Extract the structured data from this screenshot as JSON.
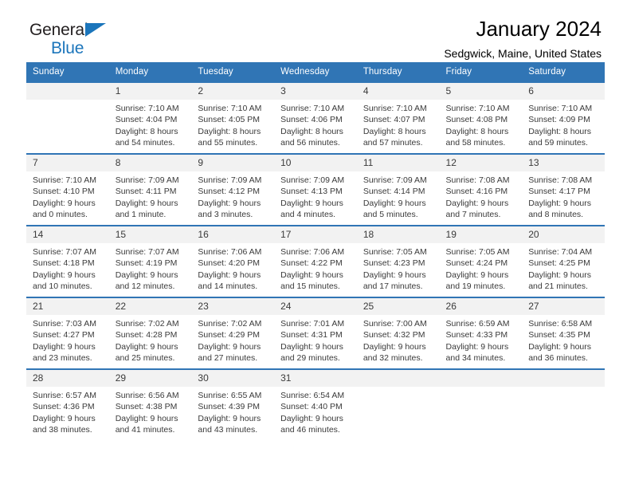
{
  "brand": {
    "line1": "General",
    "line2": "Blue",
    "accent_color": "#1b75bb"
  },
  "header": {
    "title": "January 2024",
    "subtitle": "Sedgwick, Maine, United States"
  },
  "theme": {
    "header_row_background": "#3075b5",
    "day_number_background": "#f2f2f2",
    "text_color": "#3a3a3a",
    "page_background": "#ffffff"
  },
  "weekdays": [
    "Sunday",
    "Monday",
    "Tuesday",
    "Wednesday",
    "Thursday",
    "Friday",
    "Saturday"
  ],
  "labels": {
    "sunrise_prefix": "Sunrise:",
    "sunset_prefix": "Sunset:",
    "daylight_prefix": "Daylight:"
  },
  "weeks": [
    [
      {
        "day": "",
        "empty": true
      },
      {
        "day": "1",
        "sunrise": "Sunrise: 7:10 AM",
        "sunset": "Sunset: 4:04 PM",
        "daylight1": "Daylight: 8 hours",
        "daylight2": "and 54 minutes."
      },
      {
        "day": "2",
        "sunrise": "Sunrise: 7:10 AM",
        "sunset": "Sunset: 4:05 PM",
        "daylight1": "Daylight: 8 hours",
        "daylight2": "and 55 minutes."
      },
      {
        "day": "3",
        "sunrise": "Sunrise: 7:10 AM",
        "sunset": "Sunset: 4:06 PM",
        "daylight1": "Daylight: 8 hours",
        "daylight2": "and 56 minutes."
      },
      {
        "day": "4",
        "sunrise": "Sunrise: 7:10 AM",
        "sunset": "Sunset: 4:07 PM",
        "daylight1": "Daylight: 8 hours",
        "daylight2": "and 57 minutes."
      },
      {
        "day": "5",
        "sunrise": "Sunrise: 7:10 AM",
        "sunset": "Sunset: 4:08 PM",
        "daylight1": "Daylight: 8 hours",
        "daylight2": "and 58 minutes."
      },
      {
        "day": "6",
        "sunrise": "Sunrise: 7:10 AM",
        "sunset": "Sunset: 4:09 PM",
        "daylight1": "Daylight: 8 hours",
        "daylight2": "and 59 minutes."
      }
    ],
    [
      {
        "day": "7",
        "sunrise": "Sunrise: 7:10 AM",
        "sunset": "Sunset: 4:10 PM",
        "daylight1": "Daylight: 9 hours",
        "daylight2": "and 0 minutes."
      },
      {
        "day": "8",
        "sunrise": "Sunrise: 7:09 AM",
        "sunset": "Sunset: 4:11 PM",
        "daylight1": "Daylight: 9 hours",
        "daylight2": "and 1 minute."
      },
      {
        "day": "9",
        "sunrise": "Sunrise: 7:09 AM",
        "sunset": "Sunset: 4:12 PM",
        "daylight1": "Daylight: 9 hours",
        "daylight2": "and 3 minutes."
      },
      {
        "day": "10",
        "sunrise": "Sunrise: 7:09 AM",
        "sunset": "Sunset: 4:13 PM",
        "daylight1": "Daylight: 9 hours",
        "daylight2": "and 4 minutes."
      },
      {
        "day": "11",
        "sunrise": "Sunrise: 7:09 AM",
        "sunset": "Sunset: 4:14 PM",
        "daylight1": "Daylight: 9 hours",
        "daylight2": "and 5 minutes."
      },
      {
        "day": "12",
        "sunrise": "Sunrise: 7:08 AM",
        "sunset": "Sunset: 4:16 PM",
        "daylight1": "Daylight: 9 hours",
        "daylight2": "and 7 minutes."
      },
      {
        "day": "13",
        "sunrise": "Sunrise: 7:08 AM",
        "sunset": "Sunset: 4:17 PM",
        "daylight1": "Daylight: 9 hours",
        "daylight2": "and 8 minutes."
      }
    ],
    [
      {
        "day": "14",
        "sunrise": "Sunrise: 7:07 AM",
        "sunset": "Sunset: 4:18 PM",
        "daylight1": "Daylight: 9 hours",
        "daylight2": "and 10 minutes."
      },
      {
        "day": "15",
        "sunrise": "Sunrise: 7:07 AM",
        "sunset": "Sunset: 4:19 PM",
        "daylight1": "Daylight: 9 hours",
        "daylight2": "and 12 minutes."
      },
      {
        "day": "16",
        "sunrise": "Sunrise: 7:06 AM",
        "sunset": "Sunset: 4:20 PM",
        "daylight1": "Daylight: 9 hours",
        "daylight2": "and 14 minutes."
      },
      {
        "day": "17",
        "sunrise": "Sunrise: 7:06 AM",
        "sunset": "Sunset: 4:22 PM",
        "daylight1": "Daylight: 9 hours",
        "daylight2": "and 15 minutes."
      },
      {
        "day": "18",
        "sunrise": "Sunrise: 7:05 AM",
        "sunset": "Sunset: 4:23 PM",
        "daylight1": "Daylight: 9 hours",
        "daylight2": "and 17 minutes."
      },
      {
        "day": "19",
        "sunrise": "Sunrise: 7:05 AM",
        "sunset": "Sunset: 4:24 PM",
        "daylight1": "Daylight: 9 hours",
        "daylight2": "and 19 minutes."
      },
      {
        "day": "20",
        "sunrise": "Sunrise: 7:04 AM",
        "sunset": "Sunset: 4:25 PM",
        "daylight1": "Daylight: 9 hours",
        "daylight2": "and 21 minutes."
      }
    ],
    [
      {
        "day": "21",
        "sunrise": "Sunrise: 7:03 AM",
        "sunset": "Sunset: 4:27 PM",
        "daylight1": "Daylight: 9 hours",
        "daylight2": "and 23 minutes."
      },
      {
        "day": "22",
        "sunrise": "Sunrise: 7:02 AM",
        "sunset": "Sunset: 4:28 PM",
        "daylight1": "Daylight: 9 hours",
        "daylight2": "and 25 minutes."
      },
      {
        "day": "23",
        "sunrise": "Sunrise: 7:02 AM",
        "sunset": "Sunset: 4:29 PM",
        "daylight1": "Daylight: 9 hours",
        "daylight2": "and 27 minutes."
      },
      {
        "day": "24",
        "sunrise": "Sunrise: 7:01 AM",
        "sunset": "Sunset: 4:31 PM",
        "daylight1": "Daylight: 9 hours",
        "daylight2": "and 29 minutes."
      },
      {
        "day": "25",
        "sunrise": "Sunrise: 7:00 AM",
        "sunset": "Sunset: 4:32 PM",
        "daylight1": "Daylight: 9 hours",
        "daylight2": "and 32 minutes."
      },
      {
        "day": "26",
        "sunrise": "Sunrise: 6:59 AM",
        "sunset": "Sunset: 4:33 PM",
        "daylight1": "Daylight: 9 hours",
        "daylight2": "and 34 minutes."
      },
      {
        "day": "27",
        "sunrise": "Sunrise: 6:58 AM",
        "sunset": "Sunset: 4:35 PM",
        "daylight1": "Daylight: 9 hours",
        "daylight2": "and 36 minutes."
      }
    ],
    [
      {
        "day": "28",
        "sunrise": "Sunrise: 6:57 AM",
        "sunset": "Sunset: 4:36 PM",
        "daylight1": "Daylight: 9 hours",
        "daylight2": "and 38 minutes."
      },
      {
        "day": "29",
        "sunrise": "Sunrise: 6:56 AM",
        "sunset": "Sunset: 4:38 PM",
        "daylight1": "Daylight: 9 hours",
        "daylight2": "and 41 minutes."
      },
      {
        "day": "30",
        "sunrise": "Sunrise: 6:55 AM",
        "sunset": "Sunset: 4:39 PM",
        "daylight1": "Daylight: 9 hours",
        "daylight2": "and 43 minutes."
      },
      {
        "day": "31",
        "sunrise": "Sunrise: 6:54 AM",
        "sunset": "Sunset: 4:40 PM",
        "daylight1": "Daylight: 9 hours",
        "daylight2": "and 46 minutes."
      },
      {
        "day": "",
        "empty": true
      },
      {
        "day": "",
        "empty": true
      },
      {
        "day": "",
        "empty": true
      }
    ]
  ]
}
